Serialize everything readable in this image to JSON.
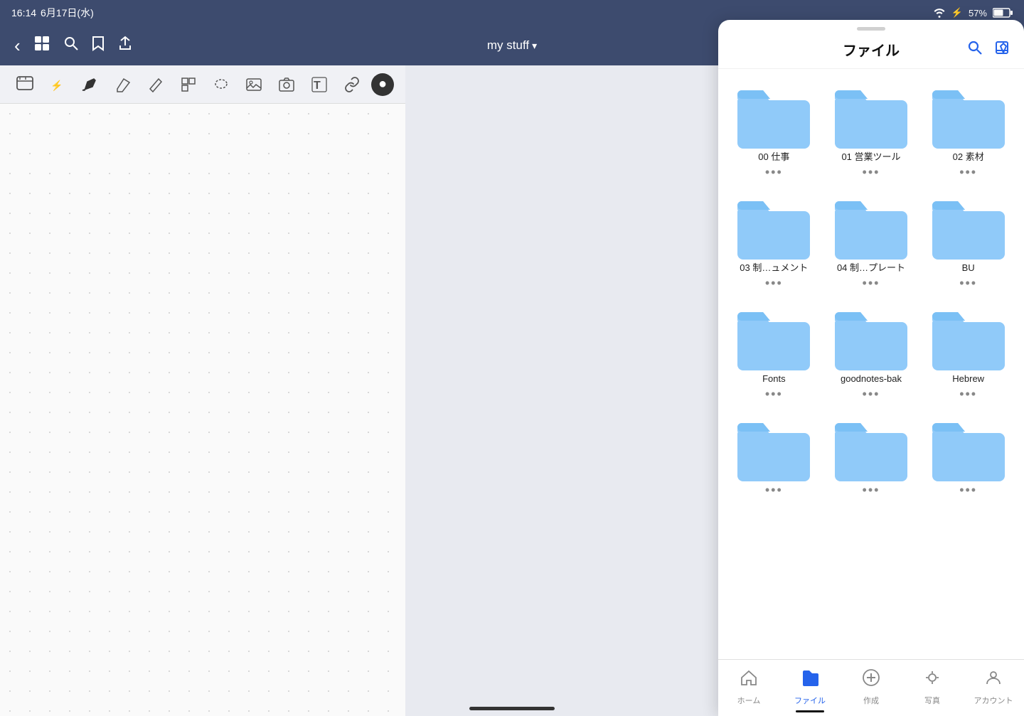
{
  "statusBar": {
    "time": "16:14",
    "date": "6月17日(水)",
    "battery": "57%",
    "wifi": "wifi",
    "bluetooth": "BT"
  },
  "navBar": {
    "title": "my stuff",
    "titleDropdown": "▾",
    "backIcon": "‹",
    "gridIcon": "⊞",
    "searchIcon": "🔍",
    "bookmarkIcon": "🔖",
    "shareIcon": "⬆"
  },
  "toolbar": {
    "tools": [
      {
        "name": "select",
        "symbol": "⬜",
        "label": "select-tool"
      },
      {
        "name": "bluetooth-pen",
        "symbol": "✎",
        "label": "bluetooth-tool"
      },
      {
        "name": "pen",
        "symbol": "✏",
        "label": "pen-tool"
      },
      {
        "name": "eraser",
        "symbol": "◇",
        "label": "eraser-tool"
      },
      {
        "name": "highlighter",
        "symbol": "⟋",
        "label": "highlighter-tool"
      },
      {
        "name": "shapes",
        "symbol": "❏",
        "label": "shapes-tool"
      },
      {
        "name": "lasso",
        "symbol": "◯",
        "label": "lasso-tool"
      },
      {
        "name": "image",
        "symbol": "⬚",
        "label": "image-tool"
      },
      {
        "name": "camera",
        "symbol": "📷",
        "label": "camera-tool"
      },
      {
        "name": "text",
        "symbol": "T",
        "label": "text-tool"
      },
      {
        "name": "link",
        "symbol": "🔗",
        "label": "link-tool"
      },
      {
        "name": "style",
        "symbol": "●",
        "label": "style-tool",
        "active": true
      }
    ]
  },
  "filePanel": {
    "title": "ファイル",
    "searchLabel": "search",
    "editLabel": "edit",
    "folders": [
      {
        "id": "f1",
        "name": "00 仕事",
        "dots": "•••"
      },
      {
        "id": "f2",
        "name": "01 営業ツール",
        "dots": "•••"
      },
      {
        "id": "f3",
        "name": "02 素材",
        "dots": "•••"
      },
      {
        "id": "f4",
        "name": "03 制…ュメント",
        "dots": "•••"
      },
      {
        "id": "f5",
        "name": "04 制…プレート",
        "dots": "•••"
      },
      {
        "id": "f6",
        "name": "BU",
        "dots": "•••"
      },
      {
        "id": "f7",
        "name": "Fonts",
        "dots": "•••"
      },
      {
        "id": "f8",
        "name": "goodnotes-bak",
        "dots": "•••"
      },
      {
        "id": "f9",
        "name": "Hebrew",
        "dots": "•••"
      },
      {
        "id": "f10",
        "name": "",
        "dots": "•••"
      },
      {
        "id": "f11",
        "name": "",
        "dots": "•••"
      },
      {
        "id": "f12",
        "name": "",
        "dots": "•••"
      }
    ],
    "tabs": [
      {
        "id": "home",
        "icon": "⌂",
        "label": "ホーム",
        "active": false
      },
      {
        "id": "files",
        "icon": "📁",
        "label": "ファイル",
        "active": true
      },
      {
        "id": "create",
        "icon": "+",
        "label": "作成",
        "active": false
      },
      {
        "id": "photos",
        "icon": "👤",
        "label": "写真",
        "active": false
      },
      {
        "id": "account",
        "icon": "👤",
        "label": "アカウント",
        "active": false
      }
    ]
  }
}
